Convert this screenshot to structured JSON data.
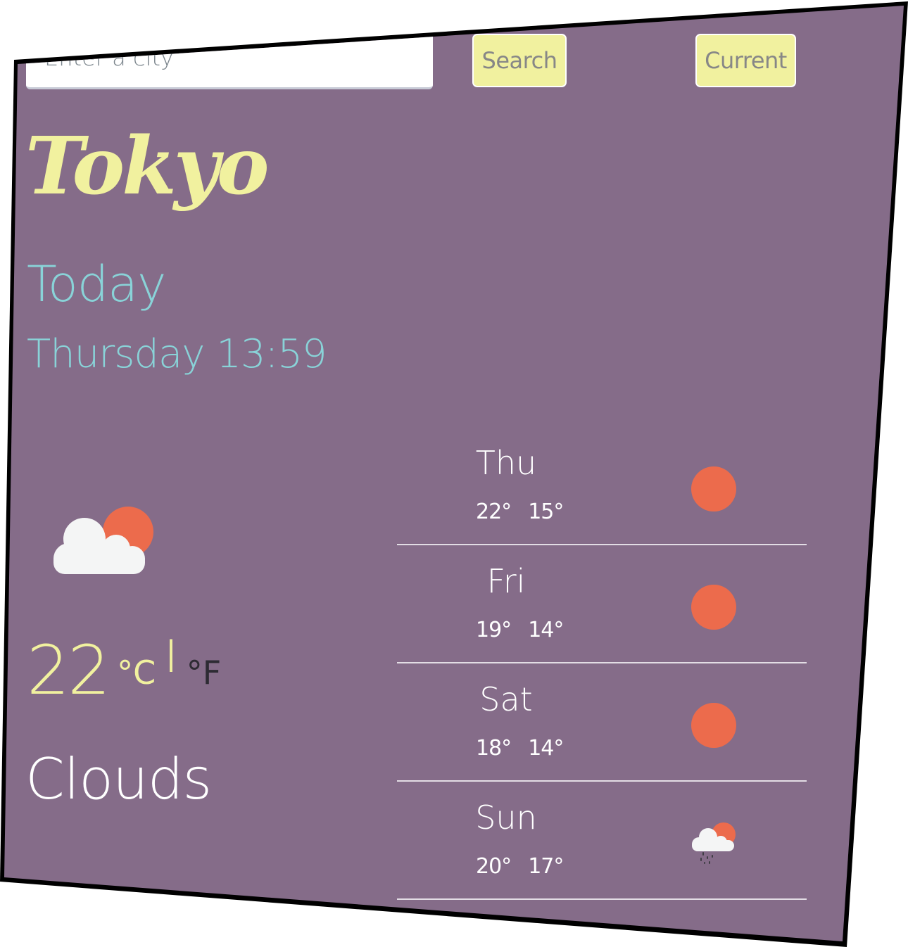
{
  "search": {
    "placeholder": "Enter a city",
    "value": "",
    "search_label": "Search",
    "current_label": "Current"
  },
  "current": {
    "city": "Tokyo",
    "heading": "Today",
    "datetime": "Thursday 13:59",
    "icon": "partly-cloudy-icon",
    "temperature": "22",
    "unit_celsius": "°C",
    "unit_separator": "|",
    "unit_fahrenheit": "°F",
    "active_unit": "C",
    "description": "Clouds"
  },
  "forecast": [
    {
      "day": "Thu",
      "high": "22°",
      "low": "15°",
      "icon": "sun-icon"
    },
    {
      "day": "Fri",
      "high": "19°",
      "low": "14°",
      "icon": "sun-icon"
    },
    {
      "day": "Sat",
      "high": "18°",
      "low": "14°",
      "icon": "sun-icon"
    },
    {
      "day": "Sun",
      "high": "20°",
      "low": "17°",
      "icon": "rain-cloud-sun-icon"
    }
  ],
  "colors": {
    "background": "#856c89",
    "accent_yellow": "#f1f19f",
    "accent_cyan": "#89d3d8",
    "sun_orange": "#ec6b4c",
    "cloud_white": "#f4f5f5",
    "text_white": "#ffffff",
    "inactive_unit": "#2d2b33"
  }
}
